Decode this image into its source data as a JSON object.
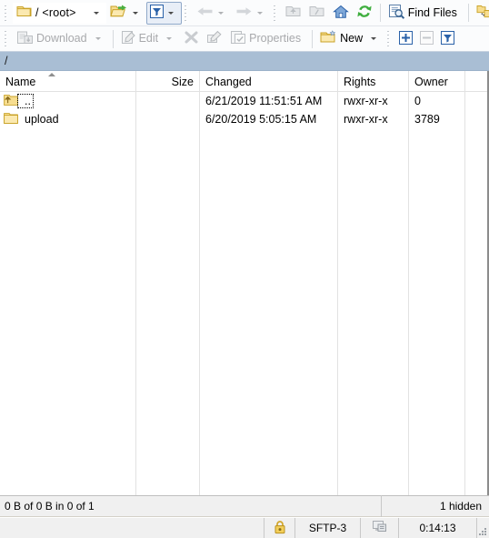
{
  "toolbar_top": {
    "path_combo": {
      "value": "/ <root>",
      "icon": "folder-icon",
      "dropdown_icon": "chevron-down-icon"
    },
    "open_dir_button": {
      "label": "",
      "icon": "open-directory-icon",
      "dropdown_icon": "chevron-down-icon"
    },
    "filter_button": {
      "label": "",
      "icon": "filter-icon",
      "dropdown_icon": "chevron-down-icon"
    },
    "back_button": {
      "label": "",
      "icon": "arrow-left-icon",
      "dropdown_icon": "chevron-down-icon"
    },
    "forward_button": {
      "label": "",
      "icon": "arrow-right-icon",
      "dropdown_icon": "chevron-down-icon"
    },
    "parent_button": {
      "icon": "folder-up-icon"
    },
    "root_button": {
      "icon": "folder-root-icon"
    },
    "home_button": {
      "icon": "home-icon"
    },
    "refresh_button": {
      "icon": "refresh-icon"
    },
    "find_files_button": {
      "label": "Find Files",
      "icon": "find-files-icon"
    },
    "synchronize_button": {
      "icon": "synchronize-browsing-icon"
    }
  },
  "toolbar_second": {
    "download_button": {
      "label": "Download",
      "icon": "download-icon",
      "enabled": false
    },
    "edit_button": {
      "label": "Edit",
      "icon": "edit-icon",
      "enabled": false
    },
    "delete_button": {
      "label": "",
      "icon": "delete-x-icon",
      "enabled": false
    },
    "rename_button": {
      "label": "",
      "icon": "rename-icon",
      "enabled": false
    },
    "properties_button": {
      "label": "Properties",
      "icon": "properties-icon",
      "enabled": false
    },
    "new_button": {
      "label": "New",
      "icon": "new-folder-icon",
      "enabled": true
    },
    "select_add_button": {
      "icon": "plus-icon",
      "enabled": true
    },
    "select_remove_button": {
      "icon": "minus-icon",
      "enabled": false
    },
    "select_filter_button": {
      "icon": "filter-select-icon",
      "enabled": true
    }
  },
  "path_bar": {
    "path": "/"
  },
  "file_list": {
    "columns": [
      {
        "key": "name",
        "label": "Name",
        "align": "left",
        "sorted": "asc"
      },
      {
        "key": "size",
        "label": "Size",
        "align": "right"
      },
      {
        "key": "changed",
        "label": "Changed",
        "align": "left"
      },
      {
        "key": "rights",
        "label": "Rights",
        "align": "left"
      },
      {
        "key": "owner",
        "label": "Owner",
        "align": "left"
      }
    ],
    "rows": [
      {
        "name": "..",
        "icon": "folder-up-icon",
        "size": "",
        "changed": "6/21/2019 11:51:51 AM",
        "rights": "rwxr-xr-x",
        "owner": "0",
        "focused": true
      },
      {
        "name": "upload",
        "icon": "folder-icon",
        "size": "",
        "changed": "6/20/2019 5:05:15 AM",
        "rights": "rwxr-xr-x",
        "owner": "3789",
        "focused": false
      }
    ]
  },
  "list_status": {
    "selection": "0 B of 0 B in 0 of 1",
    "hidden": "1 hidden"
  },
  "window_status": {
    "lock_icon": "padlock-icon",
    "protocol": "SFTP-3",
    "connection_icon": "connection-icon",
    "duration": "0:14:13"
  },
  "colors": {
    "path_bar_bg": "#a9bed4",
    "toolbar_bg": "#fbfcfd",
    "status_bg": "#f0f0f0",
    "folder_yellow": "#f5d77e",
    "accent_blue": "#2a61a8"
  }
}
